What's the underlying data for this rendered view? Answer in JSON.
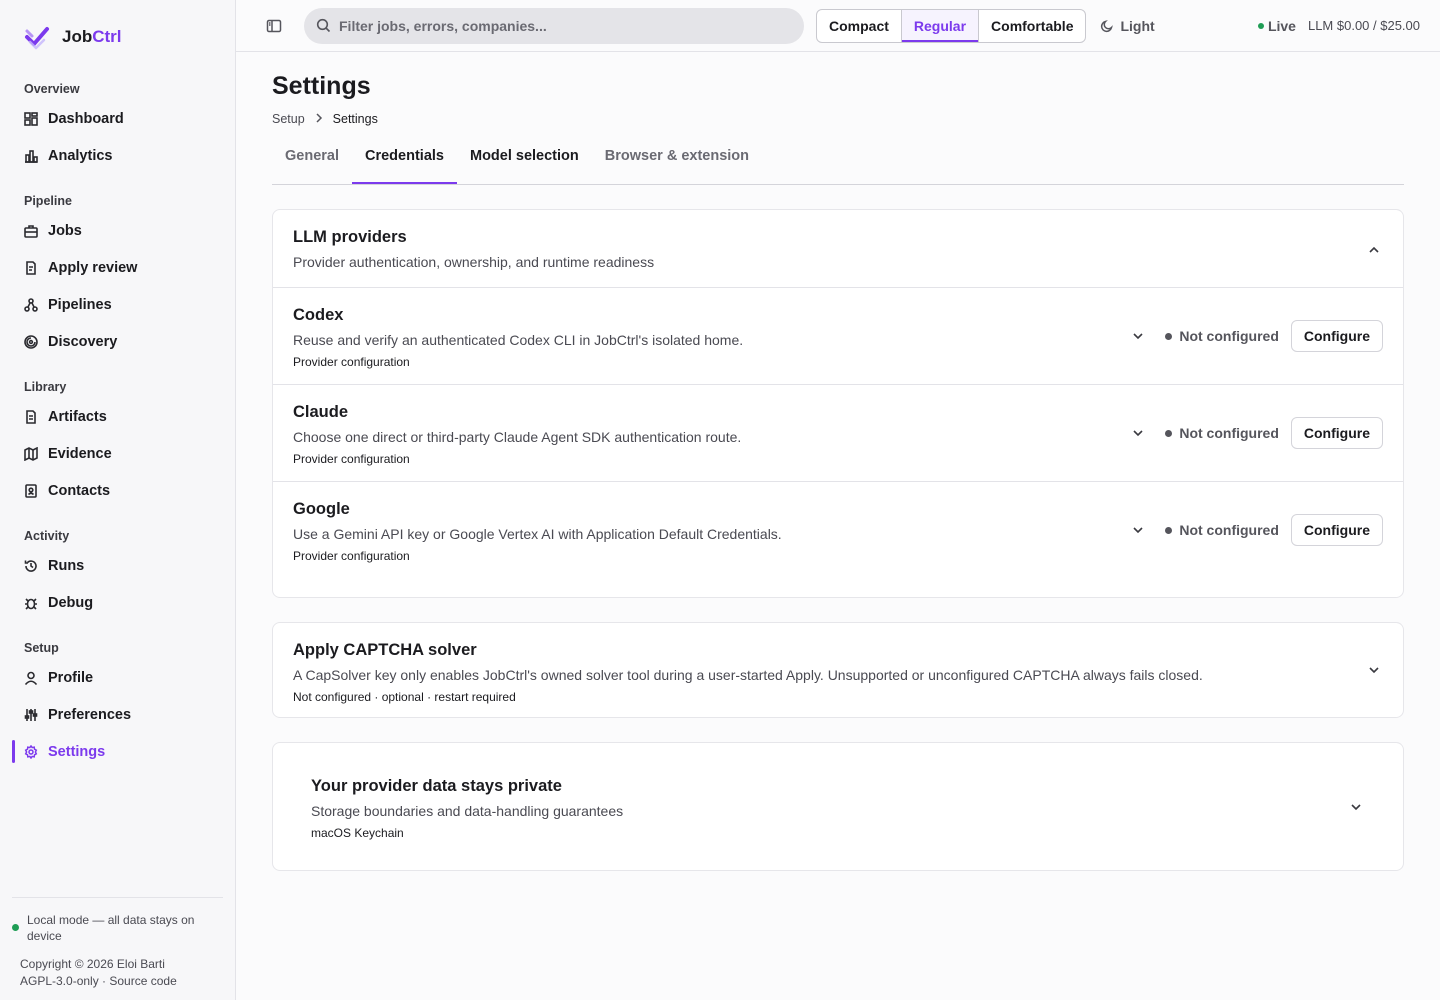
{
  "brand": {
    "name_part1": "Job",
    "name_part2": "Ctrl",
    "accent_color": "#7c3aed"
  },
  "sidebar": {
    "sections": [
      {
        "title": "Overview",
        "items": [
          {
            "label": "Dashboard",
            "icon": "dashboard-icon"
          },
          {
            "label": "Analytics",
            "icon": "chart-icon"
          }
        ]
      },
      {
        "title": "Pipeline",
        "items": [
          {
            "label": "Jobs",
            "icon": "briefcase-icon"
          },
          {
            "label": "Apply review",
            "icon": "review-icon"
          },
          {
            "label": "Pipelines",
            "icon": "pipeline-icon"
          },
          {
            "label": "Discovery",
            "icon": "discovery-icon"
          }
        ]
      },
      {
        "title": "Library",
        "items": [
          {
            "label": "Artifacts",
            "icon": "file-icon"
          },
          {
            "label": "Evidence",
            "icon": "map-icon"
          },
          {
            "label": "Contacts",
            "icon": "contacts-icon"
          }
        ]
      },
      {
        "title": "Activity",
        "items": [
          {
            "label": "Runs",
            "icon": "history-icon"
          },
          {
            "label": "Debug",
            "icon": "bug-icon"
          }
        ]
      },
      {
        "title": "Setup",
        "items": [
          {
            "label": "Profile",
            "icon": "user-icon"
          },
          {
            "label": "Preferences",
            "icon": "sliders-icon"
          },
          {
            "label": "Settings",
            "icon": "gear-icon"
          }
        ]
      }
    ],
    "active_item": "Settings",
    "footer": {
      "local_mode": "Local mode — all data stays on device",
      "copyright": "Copyright © 2026 Eloi Barti",
      "license": "AGPL-3.0-only · Source code"
    }
  },
  "topbar": {
    "search_placeholder": "Filter jobs, errors, companies...",
    "density_options": [
      "Compact",
      "Regular",
      "Comfortable"
    ],
    "density_selected": "Regular",
    "theme_label": "Light",
    "live_label": "Live",
    "llm_budget": "LLM $0.00 / $25.00"
  },
  "page": {
    "title": "Settings",
    "breadcrumb": [
      "Setup",
      "Settings"
    ],
    "tabs": [
      "General",
      "Credentials",
      "Model selection",
      "Browser & extension"
    ],
    "active_tab": "Credentials"
  },
  "llm_providers": {
    "title": "LLM providers",
    "subtitle": "Provider authentication, ownership, and runtime readiness",
    "providers": [
      {
        "name": "Codex",
        "description": "Reuse and verify an authenticated Codex CLI in JobCtrl's isolated home.",
        "meta": "Provider configuration",
        "status": "Not configured",
        "action": "Configure"
      },
      {
        "name": "Claude",
        "description": "Choose one direct or third-party Claude Agent SDK authentication route.",
        "meta": "Provider configuration",
        "status": "Not configured",
        "action": "Configure"
      },
      {
        "name": "Google",
        "description": "Use a Gemini API key or Google Vertex AI with Application Default Credentials.",
        "meta": "Provider configuration",
        "status": "Not configured",
        "action": "Configure"
      }
    ]
  },
  "captcha": {
    "title": "Apply CAPTCHA solver",
    "description": "A CapSolver key only enables JobCtrl's owned solver tool during a user-started Apply. Unsupported or unconfigured CAPTCHA always fails closed.",
    "meta": "Not configured · optional · restart required"
  },
  "privacy": {
    "title": "Your provider data stays private",
    "subtitle": "Storage boundaries and data-handling guarantees",
    "meta": "macOS Keychain"
  }
}
